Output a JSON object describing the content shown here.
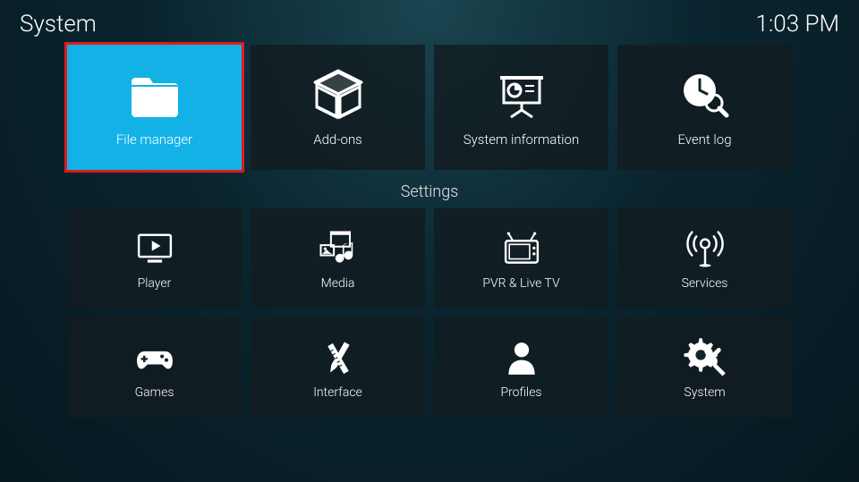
{
  "header": {
    "title": "System",
    "time": "1:03 PM"
  },
  "topRow": [
    {
      "label": "File manager",
      "icon": "folder",
      "highlighted": true
    },
    {
      "label": "Add-ons",
      "icon": "box",
      "highlighted": false
    },
    {
      "label": "System information",
      "icon": "presentation",
      "highlighted": false
    },
    {
      "label": "Event log",
      "icon": "clock-search",
      "highlighted": false
    }
  ],
  "sectionLabel": "Settings",
  "settingsRows": [
    [
      {
        "label": "Player",
        "icon": "monitor-play"
      },
      {
        "label": "Media",
        "icon": "media-collection"
      },
      {
        "label": "PVR & Live TV",
        "icon": "tv"
      },
      {
        "label": "Services",
        "icon": "broadcast"
      }
    ],
    [
      {
        "label": "Games",
        "icon": "gamepad"
      },
      {
        "label": "Interface",
        "icon": "pencil-ruler"
      },
      {
        "label": "Profiles",
        "icon": "person"
      },
      {
        "label": "System",
        "icon": "gear-tools"
      }
    ]
  ]
}
